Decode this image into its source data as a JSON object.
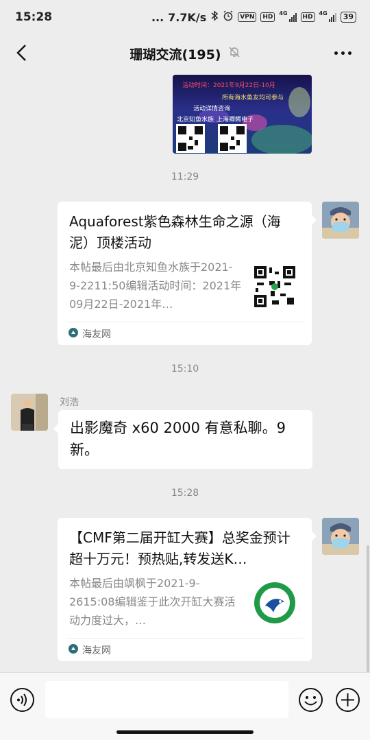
{
  "status_bar": {
    "time": "15:28",
    "dots": "...",
    "network_speed": "7.7K/s",
    "vpn": "VPN",
    "hd1": "HD",
    "hd2": "HD",
    "net1": "4G",
    "net2": "4G",
    "battery": "39"
  },
  "header": {
    "title": "珊瑚交流(195)"
  },
  "messages": {
    "time1": "11:29",
    "card1": {
      "title": "Aquaforest紫色森林生命之源（海泥）顶楼活动",
      "desc": "本帖最后由北京知鱼水族于2021-9-2211:50编辑活动时间：2021年09月22日-2021年…",
      "source": "海友网"
    },
    "time2": "15:10",
    "sender_name": "刘浩",
    "text_message": "出影魔奇 x60  2000 有意私聊。9新。",
    "time3": "15:28",
    "card2": {
      "title": "【CMF第二届开缸大赛】总奖金预计超十万元！预热贴,转发送K…",
      "desc": "本帖最后由飒枫于2021-9-2615:08编辑鉴于此次开缸大赛活动力度过大，…",
      "source": "海友网"
    },
    "top_image": {
      "line1": "活动时间：2021年9月22日-10月",
      "line2": "所有海水鱼友均可参与",
      "line3": "活动详情咨询",
      "line4": "北京知鱼水族",
      "line5": "上海卿鳄电子"
    }
  },
  "input_bar": {
    "placeholder": ""
  },
  "colors": {
    "background": "#ededed",
    "bubble": "#ffffff",
    "muted": "#888888"
  }
}
